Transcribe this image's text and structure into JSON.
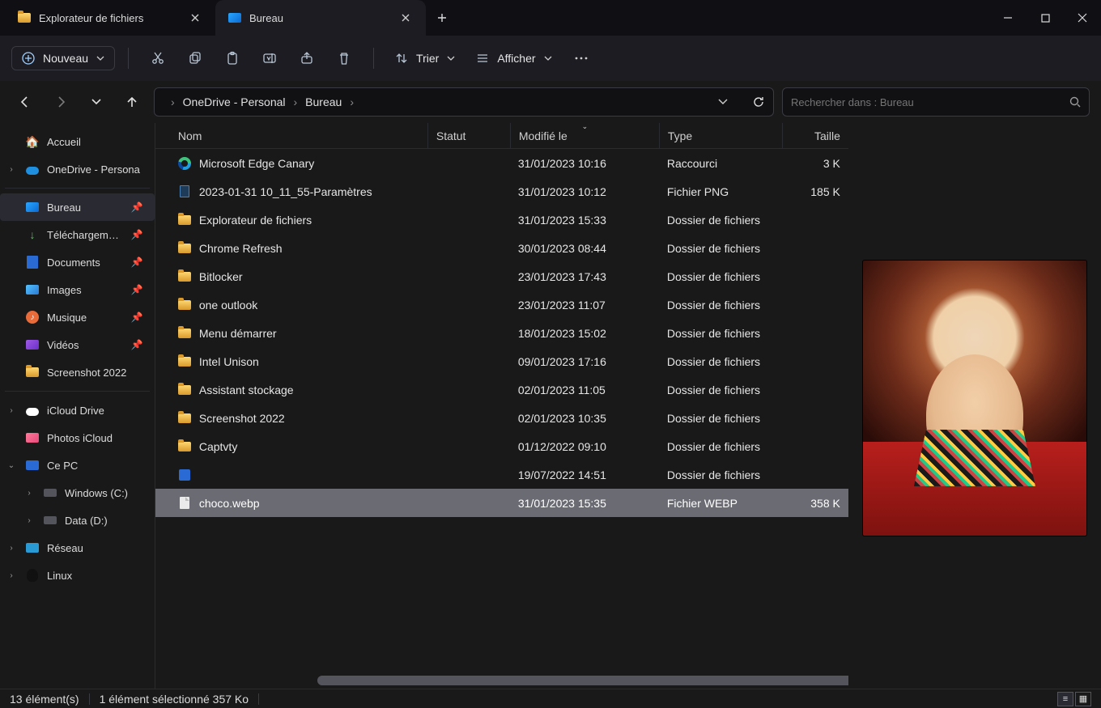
{
  "tabs": [
    {
      "label": "Explorateur de fichiers",
      "active": false
    },
    {
      "label": "Bureau",
      "active": true
    }
  ],
  "toolbar": {
    "new_label": "Nouveau",
    "sort_label": "Trier",
    "view_label": "Afficher"
  },
  "breadcrumb": {
    "root": "OneDrive - Personal",
    "leaf": "Bureau"
  },
  "search": {
    "placeholder": "Rechercher dans : Bureau"
  },
  "sidebar": {
    "home": "Accueil",
    "onedrive": "OneDrive - Persona",
    "quick": [
      {
        "label": "Bureau",
        "icon": "desktop",
        "active": true
      },
      {
        "label": "Téléchargements",
        "icon": "download"
      },
      {
        "label": "Documents",
        "icon": "docs"
      },
      {
        "label": "Images",
        "icon": "pictures"
      },
      {
        "label": "Musique",
        "icon": "music"
      },
      {
        "label": "Vidéos",
        "icon": "video"
      },
      {
        "label": "Screenshot 2022",
        "icon": "folder",
        "nopin": true
      }
    ],
    "places": [
      {
        "label": "iCloud Drive",
        "icon": "cloud",
        "chev": true
      },
      {
        "label": "Photos iCloud",
        "icon": "pictures-cloud",
        "chev": false
      },
      {
        "label": "Ce PC",
        "icon": "pc",
        "chev": true,
        "open": true
      },
      {
        "label": "Windows (C:)",
        "icon": "drive",
        "indent": true,
        "chev": true
      },
      {
        "label": "Data (D:)",
        "icon": "drive",
        "indent": true,
        "chev": true
      },
      {
        "label": "Réseau",
        "icon": "net",
        "chev": true
      },
      {
        "label": "Linux",
        "icon": "linux",
        "chev": true
      }
    ]
  },
  "columns": {
    "name": "Nom",
    "status": "Statut",
    "modified": "Modifié le",
    "type": "Type",
    "size": "Taille"
  },
  "files": [
    {
      "icon": "edge",
      "name": "Microsoft Edge Canary",
      "modified": "31/01/2023 10:16",
      "type": "Raccourci",
      "size": "3 K"
    },
    {
      "icon": "png",
      "name": "2023-01-31 10_11_55-Paramètres",
      "modified": "31/01/2023 10:12",
      "type": "Fichier PNG",
      "size": "185 K"
    },
    {
      "icon": "folder",
      "name": "Explorateur de fichiers",
      "modified": "31/01/2023 15:33",
      "type": "Dossier de fichiers",
      "size": ""
    },
    {
      "icon": "folder",
      "name": "Chrome Refresh",
      "modified": "30/01/2023 08:44",
      "type": "Dossier de fichiers",
      "size": ""
    },
    {
      "icon": "folder",
      "name": "Bitlocker",
      "modified": "23/01/2023 17:43",
      "type": "Dossier de fichiers",
      "size": ""
    },
    {
      "icon": "folder",
      "name": "one outlook",
      "modified": "23/01/2023 11:07",
      "type": "Dossier de fichiers",
      "size": ""
    },
    {
      "icon": "folder",
      "name": "Menu démarrer",
      "modified": "18/01/2023 15:02",
      "type": "Dossier de fichiers",
      "size": ""
    },
    {
      "icon": "folder",
      "name": "Intel Unison",
      "modified": "09/01/2023 17:16",
      "type": "Dossier de fichiers",
      "size": ""
    },
    {
      "icon": "folder",
      "name": "Assistant stockage",
      "modified": "02/01/2023 11:05",
      "type": "Dossier de fichiers",
      "size": ""
    },
    {
      "icon": "folder",
      "name": "Screenshot 2022",
      "modified": "02/01/2023 10:35",
      "type": "Dossier de fichiers",
      "size": ""
    },
    {
      "icon": "folder",
      "name": "Captvty",
      "modified": "01/12/2022 09:10",
      "type": "Dossier de fichiers",
      "size": ""
    },
    {
      "icon": "word",
      "name": "",
      "modified": "19/07/2022 14:51",
      "type": "Dossier de fichiers",
      "size": ""
    },
    {
      "icon": "file",
      "name": "choco.webp",
      "modified": "31/01/2023 15:35",
      "type": "Fichier WEBP",
      "size": "358 K",
      "selected": true
    }
  ],
  "status": {
    "count": "13 élément(s)",
    "selection": "1 élément sélectionné  357 Ko"
  }
}
